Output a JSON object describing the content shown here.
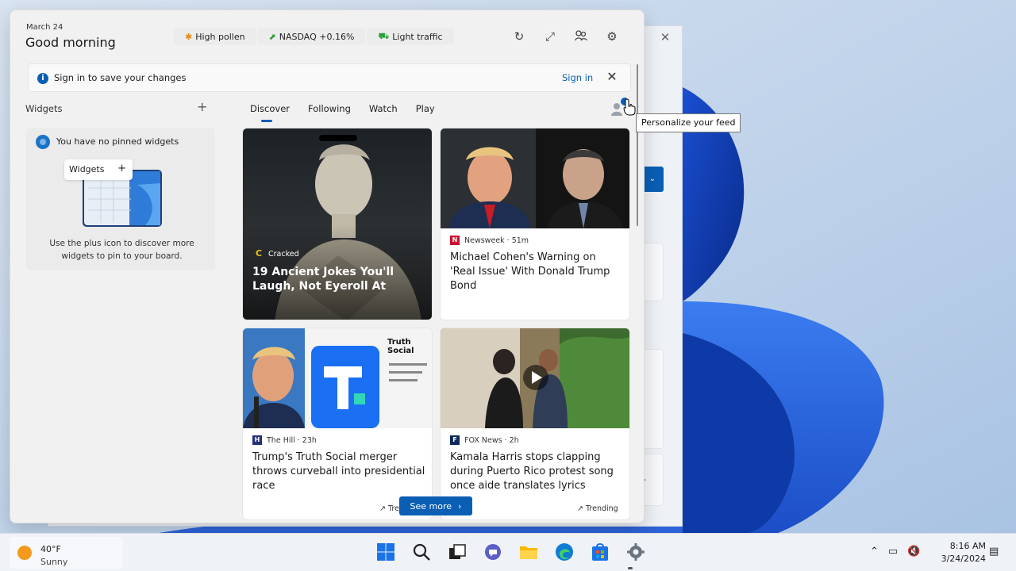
{
  "panel": {
    "date": "March 24",
    "greeting": "Good morning",
    "chips": [
      {
        "icon": "pollen-icon",
        "label": "High pollen"
      },
      {
        "icon": "stock-up-icon",
        "label": "NASDAQ +0.16%"
      },
      {
        "icon": "traffic-icon",
        "label": "Light traffic"
      }
    ],
    "header_icons": [
      "refresh-icon",
      "expand-icon",
      "account-icon",
      "gear-icon"
    ]
  },
  "signin_bar": {
    "message": "Sign in to save your changes",
    "link": "Sign in"
  },
  "widgets": {
    "title": "Widgets",
    "empty_title": "You have no pinned widgets",
    "illustration_label": "Widgets",
    "empty_desc": "Use the plus icon to discover more widgets to pin to your board."
  },
  "tabs": [
    "Discover",
    "Following",
    "Watch",
    "Play"
  ],
  "tooltip": "Personalize your feed",
  "cards": [
    {
      "source": "Cracked",
      "title": "19 Ancient Jokes You'll Laugh, Not Eyeroll At"
    },
    {
      "source": "Newsweek · 51m",
      "title": "Michael Cohen's Warning on 'Real Issue' With Donald Trump Bond"
    },
    {
      "source": "The Hill · 23h",
      "title": "Trump's Truth Social merger throws curveball into presidential race",
      "trending": "Tre"
    },
    {
      "source": "FOX News · 2h",
      "title": "Kamala Harris stops clapping during Puerto Rico protest song once aide translates lyrics",
      "trending": "Trending"
    }
  ],
  "truth_social_text": "Truth Social",
  "see_more": "See more",
  "taskbar": {
    "temp": "40°F",
    "condition": "Sunny",
    "time": "8:16 AM",
    "date": "3/24/2024",
    "apps": [
      "start-icon",
      "search-icon",
      "task-view-icon",
      "chat-icon",
      "file-explorer-icon",
      "edge-icon",
      "store-icon",
      "settings-icon"
    ]
  },
  "colors": {
    "accent": "#0a5fb4",
    "wallpaper": "#c9d9ee"
  }
}
